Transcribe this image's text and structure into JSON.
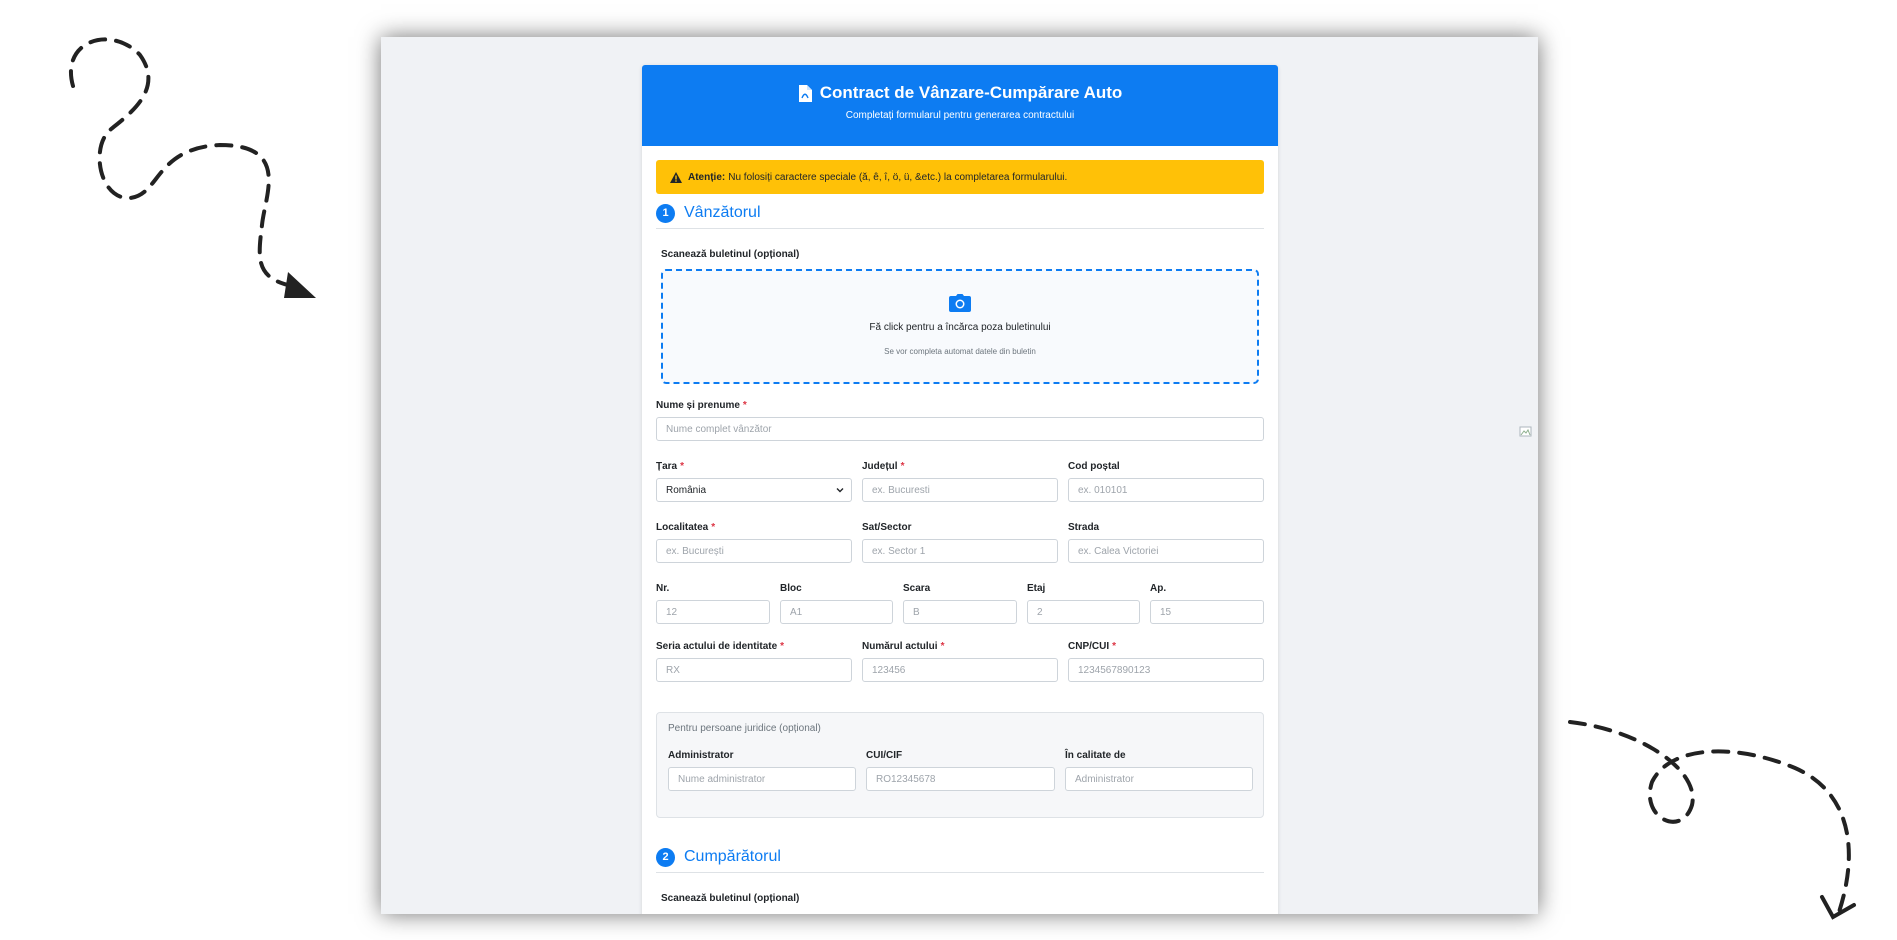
{
  "form": {
    "title": "Contract de Vânzare-Cumpărare Auto",
    "subtitle": "Completați formularul pentru generarea contractului",
    "alert": {
      "label": "Atenție:",
      "text": "Nu folosiți caractere speciale (ă, ê, î, ö, ü, &etc.) la completarea formularului."
    },
    "seller": {
      "number": "1",
      "title": "Vânzătorul",
      "scan_label": "Scanează buletinul (opțional)",
      "upload_main": "Fă click pentru a încărca poza buletinului",
      "upload_hint": "Se vor completa automat datele din buletin",
      "full_name": {
        "label": "Nume și prenume",
        "placeholder": "Nume complet vânzător"
      },
      "country": {
        "label": "Țara",
        "value": "România"
      },
      "county": {
        "label": "Județul",
        "placeholder": "ex. Bucuresti"
      },
      "postal": {
        "label": "Cod poștal",
        "placeholder": "ex. 010101"
      },
      "locality": {
        "label": "Localitatea",
        "placeholder": "ex. București"
      },
      "village": {
        "label": "Sat/Sector",
        "placeholder": "ex. Sector 1"
      },
      "street": {
        "label": "Strada",
        "placeholder": "ex. Calea Victoriei"
      },
      "nr": {
        "label": "Nr.",
        "placeholder": "12"
      },
      "bloc": {
        "label": "Bloc",
        "placeholder": "A1"
      },
      "scara": {
        "label": "Scara",
        "placeholder": "B"
      },
      "etaj": {
        "label": "Etaj",
        "placeholder": "2"
      },
      "ap": {
        "label": "Ap.",
        "placeholder": "15"
      },
      "id_series": {
        "label": "Seria actului de identitate",
        "placeholder": "RX"
      },
      "id_number": {
        "label": "Numărul actului",
        "placeholder": "123456"
      },
      "cnp": {
        "label": "CNP/CUI",
        "placeholder": "1234567890123"
      },
      "legal": {
        "title": "Pentru persoane juridice (opțional)",
        "admin": {
          "label": "Administrator",
          "placeholder": "Nume administrator"
        },
        "cui": {
          "label": "CUI/CIF",
          "placeholder": "RO12345678"
        },
        "role": {
          "label": "În calitate de",
          "placeholder": "Administrator"
        }
      }
    },
    "buyer": {
      "number": "2",
      "title": "Cumpărătorul",
      "scan_label": "Scanează buletinul (opțional)"
    }
  },
  "colors": {
    "primary": "#0d7cf2",
    "warning": "#ffc107",
    "required": "#dc3545"
  },
  "icons": [
    "pdf-file-icon",
    "warning-icon",
    "camera-icon",
    "select-caret-icon",
    "broken-image-icon"
  ]
}
